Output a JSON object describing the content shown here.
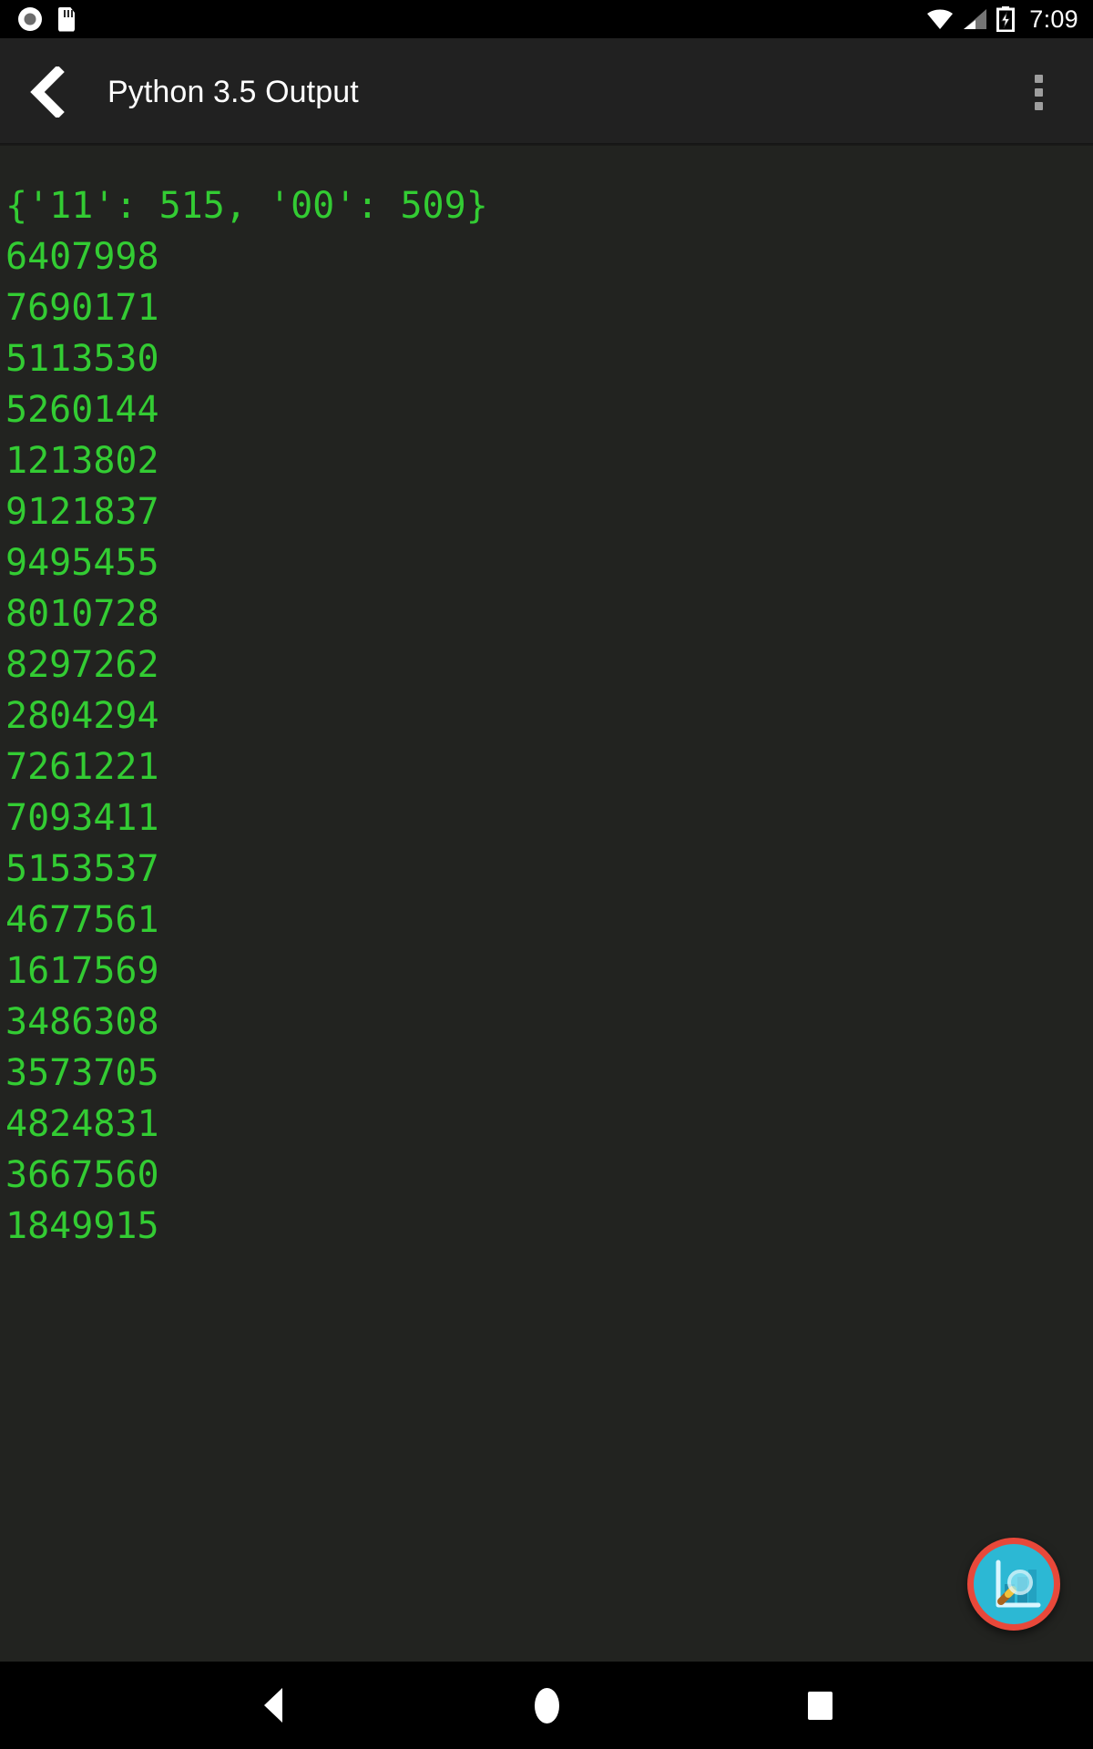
{
  "status_bar": {
    "icons_left": [
      "screen-record-icon",
      "sd-card-icon"
    ],
    "icons_right": [
      "wifi-icon",
      "cellular-signal-icon",
      "battery-charging-icon"
    ],
    "clock": "7:09"
  },
  "app_bar": {
    "back_icon": "back-chevron-icon",
    "title": "Python 3.5 Output",
    "overflow_icon": "overflow-menu-icon"
  },
  "console": {
    "text_color": "#33cc33",
    "background_color": "#222320",
    "lines": [
      "{'11': 515, '00': 509}",
      "6407998",
      "7690171",
      "5113530",
      "5260144",
      "1213802",
      "9121837",
      "9495455",
      "8010728",
      "8297262",
      "2804294",
      "7261221",
      "7093411",
      "5153537",
      "4677561",
      "1617569",
      "3486308",
      "3573705",
      "4824831",
      "3667560",
      "1849915"
    ],
    "output_text": "{'11': 515, '00': 509}\n6407998\n7690171\n5113530\n5260144\n1213802\n9121837\n9495455\n8010728\n8297262\n2804294\n7261221\n7093411\n5153537\n4677561\n1617569\n3486308\n3573705\n4824831\n3667560\n1849915"
  },
  "fab": {
    "icon": "chart-magnifier-icon",
    "background_color": "#2cb8d4",
    "border_color": "#e8483a"
  },
  "nav_bar": {
    "back_icon": "nav-back-triangle-icon",
    "home_icon": "nav-home-circle-icon",
    "recents_icon": "nav-recents-square-icon"
  }
}
